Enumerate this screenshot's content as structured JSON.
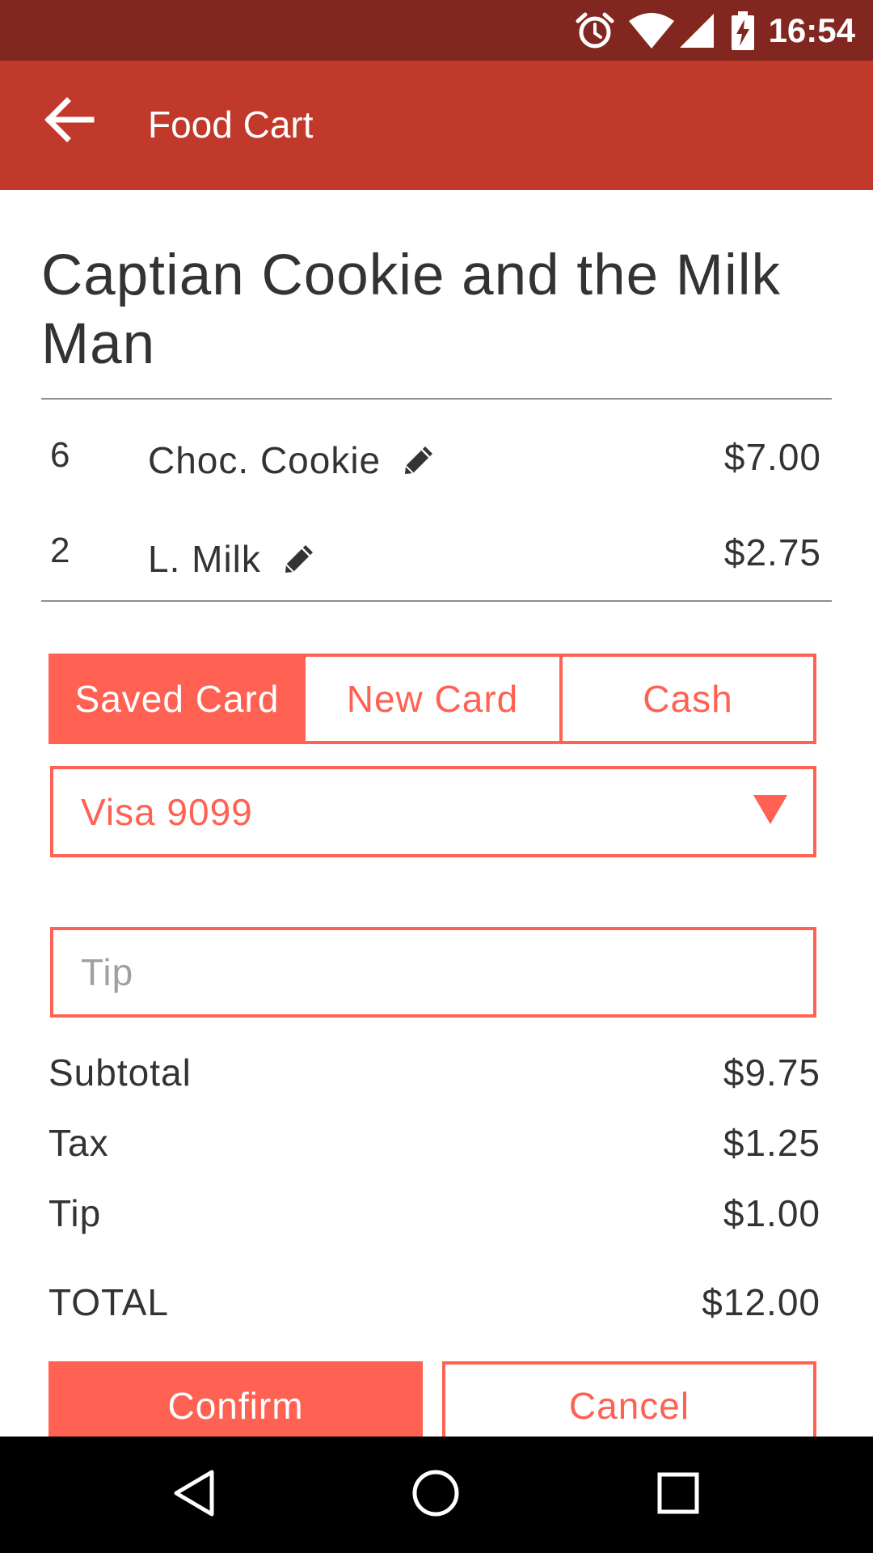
{
  "status_bar": {
    "time": "16:54",
    "icons": [
      "alarm-icon",
      "wifi-icon",
      "cell-signal-icon",
      "battery-charging-icon"
    ]
  },
  "app_bar": {
    "title": "Food Cart",
    "back_icon": "arrow-back-icon"
  },
  "store": {
    "name": "Captian Cookie and the Milk Man"
  },
  "cart": {
    "items": [
      {
        "qty": "6",
        "name": "Choc. Cookie",
        "price": "$7.00",
        "icon": "pencil-icon"
      },
      {
        "qty": "2",
        "name": "L. Milk",
        "price": "$2.75",
        "icon": "pencil-icon"
      }
    ]
  },
  "payment": {
    "tabs": [
      {
        "label": "Saved Card",
        "selected": true
      },
      {
        "label": "New Card",
        "selected": false
      },
      {
        "label": "Cash",
        "selected": false
      }
    ],
    "card_select": {
      "value": "Visa 9099",
      "icon": "dropdown-triangle-icon"
    },
    "tip_input": {
      "placeholder": "Tip",
      "value": ""
    }
  },
  "summary": {
    "subtotal": {
      "label": "Subtotal",
      "value": "$9.75"
    },
    "tax": {
      "label": "Tax",
      "value": "$1.25"
    },
    "tip": {
      "label": "Tip",
      "value": "$1.00"
    },
    "total": {
      "label": "TOTAL",
      "value": "$12.00"
    }
  },
  "actions": {
    "confirm_label": "Confirm",
    "cancel_label": "Cancel"
  },
  "nav_bar": {
    "icons": [
      "nav-back-icon",
      "nav-home-icon",
      "nav-recents-icon"
    ]
  },
  "colors": {
    "status_bar": "#822620",
    "app_bar": "#c0392b",
    "accent": "#ff6152",
    "text": "#333333",
    "divider": "#8f8f8f",
    "nav_bar": "#000000"
  }
}
